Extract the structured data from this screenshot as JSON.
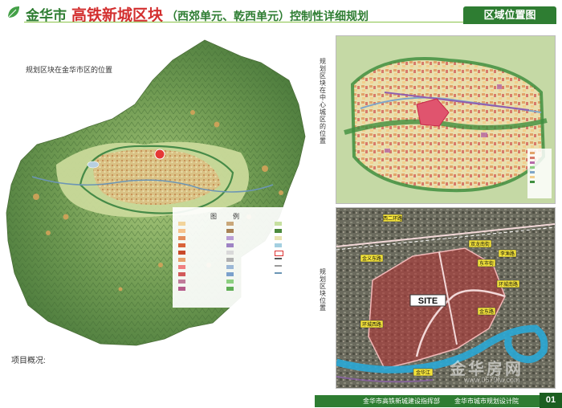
{
  "header": {
    "city": "金华市",
    "highlight": "高铁新城区块",
    "rest": "（西郊单元、乾西单元）控制性详细规划",
    "tab": "区域位置图"
  },
  "left": {
    "overview_label": "规划区块在金华市区的位置",
    "legend_title": "图　例",
    "project_label": "项目概况:"
  },
  "right": {
    "center_label": "规划区块在中心城区的位置",
    "site_label": "规划区块位置",
    "site_marker": "SITE",
    "road_labels": [
      "西二环路",
      "金义东路",
      "双龙南街",
      "东市街",
      "金华江",
      "环城南路",
      "环城西路",
      "李渔路",
      "金东路"
    ]
  },
  "footer": {
    "text1": "金华市高铁新城建设指挥部",
    "text2": "金华市城市规划设计院",
    "page": "01"
  },
  "watermark": {
    "text": "金华房网",
    "url": "www.0579fw.com"
  },
  "colors": {
    "brand_green": "#2e7d32",
    "highlight_red": "#d32f2f",
    "site_overlay": "#b03a3a"
  }
}
